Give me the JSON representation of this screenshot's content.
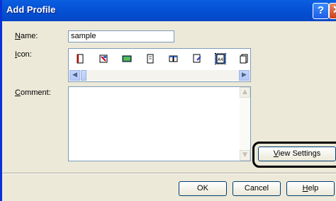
{
  "window": {
    "title": "Add Profile",
    "help_glyph": "?",
    "close_glyph": "✕"
  },
  "fields": {
    "name_label_mnemonic": "N",
    "name_label_rest": "ame:",
    "name_value": "sample",
    "icon_label_mnemonic": "I",
    "icon_label_rest": "con:",
    "comment_label_mnemonic": "C",
    "comment_label_rest": "omment:",
    "comment_value": ""
  },
  "icons": [
    {
      "name": "portrait-document-icon"
    },
    {
      "name": "landscape-image-document-icon"
    },
    {
      "name": "photo-document-icon"
    },
    {
      "name": "portrait-document-icon-2"
    },
    {
      "name": "two-pages-icon"
    },
    {
      "name": "document-edit-icon"
    },
    {
      "name": "a4-page-icon",
      "text": "A4",
      "selected": true
    },
    {
      "name": "stacked-document-icon"
    }
  ],
  "buttons": {
    "view_settings_mnemonic": "V",
    "view_settings_rest": "iew Settings",
    "ok": "OK",
    "cancel": "Cancel",
    "help_mnemonic": "H",
    "help_rest": "elp"
  },
  "colors": {
    "title_bar": "#0653d6",
    "dialog_bg": "#ece9d8",
    "selection": "#316ac5",
    "close_button": "#c8411d"
  }
}
